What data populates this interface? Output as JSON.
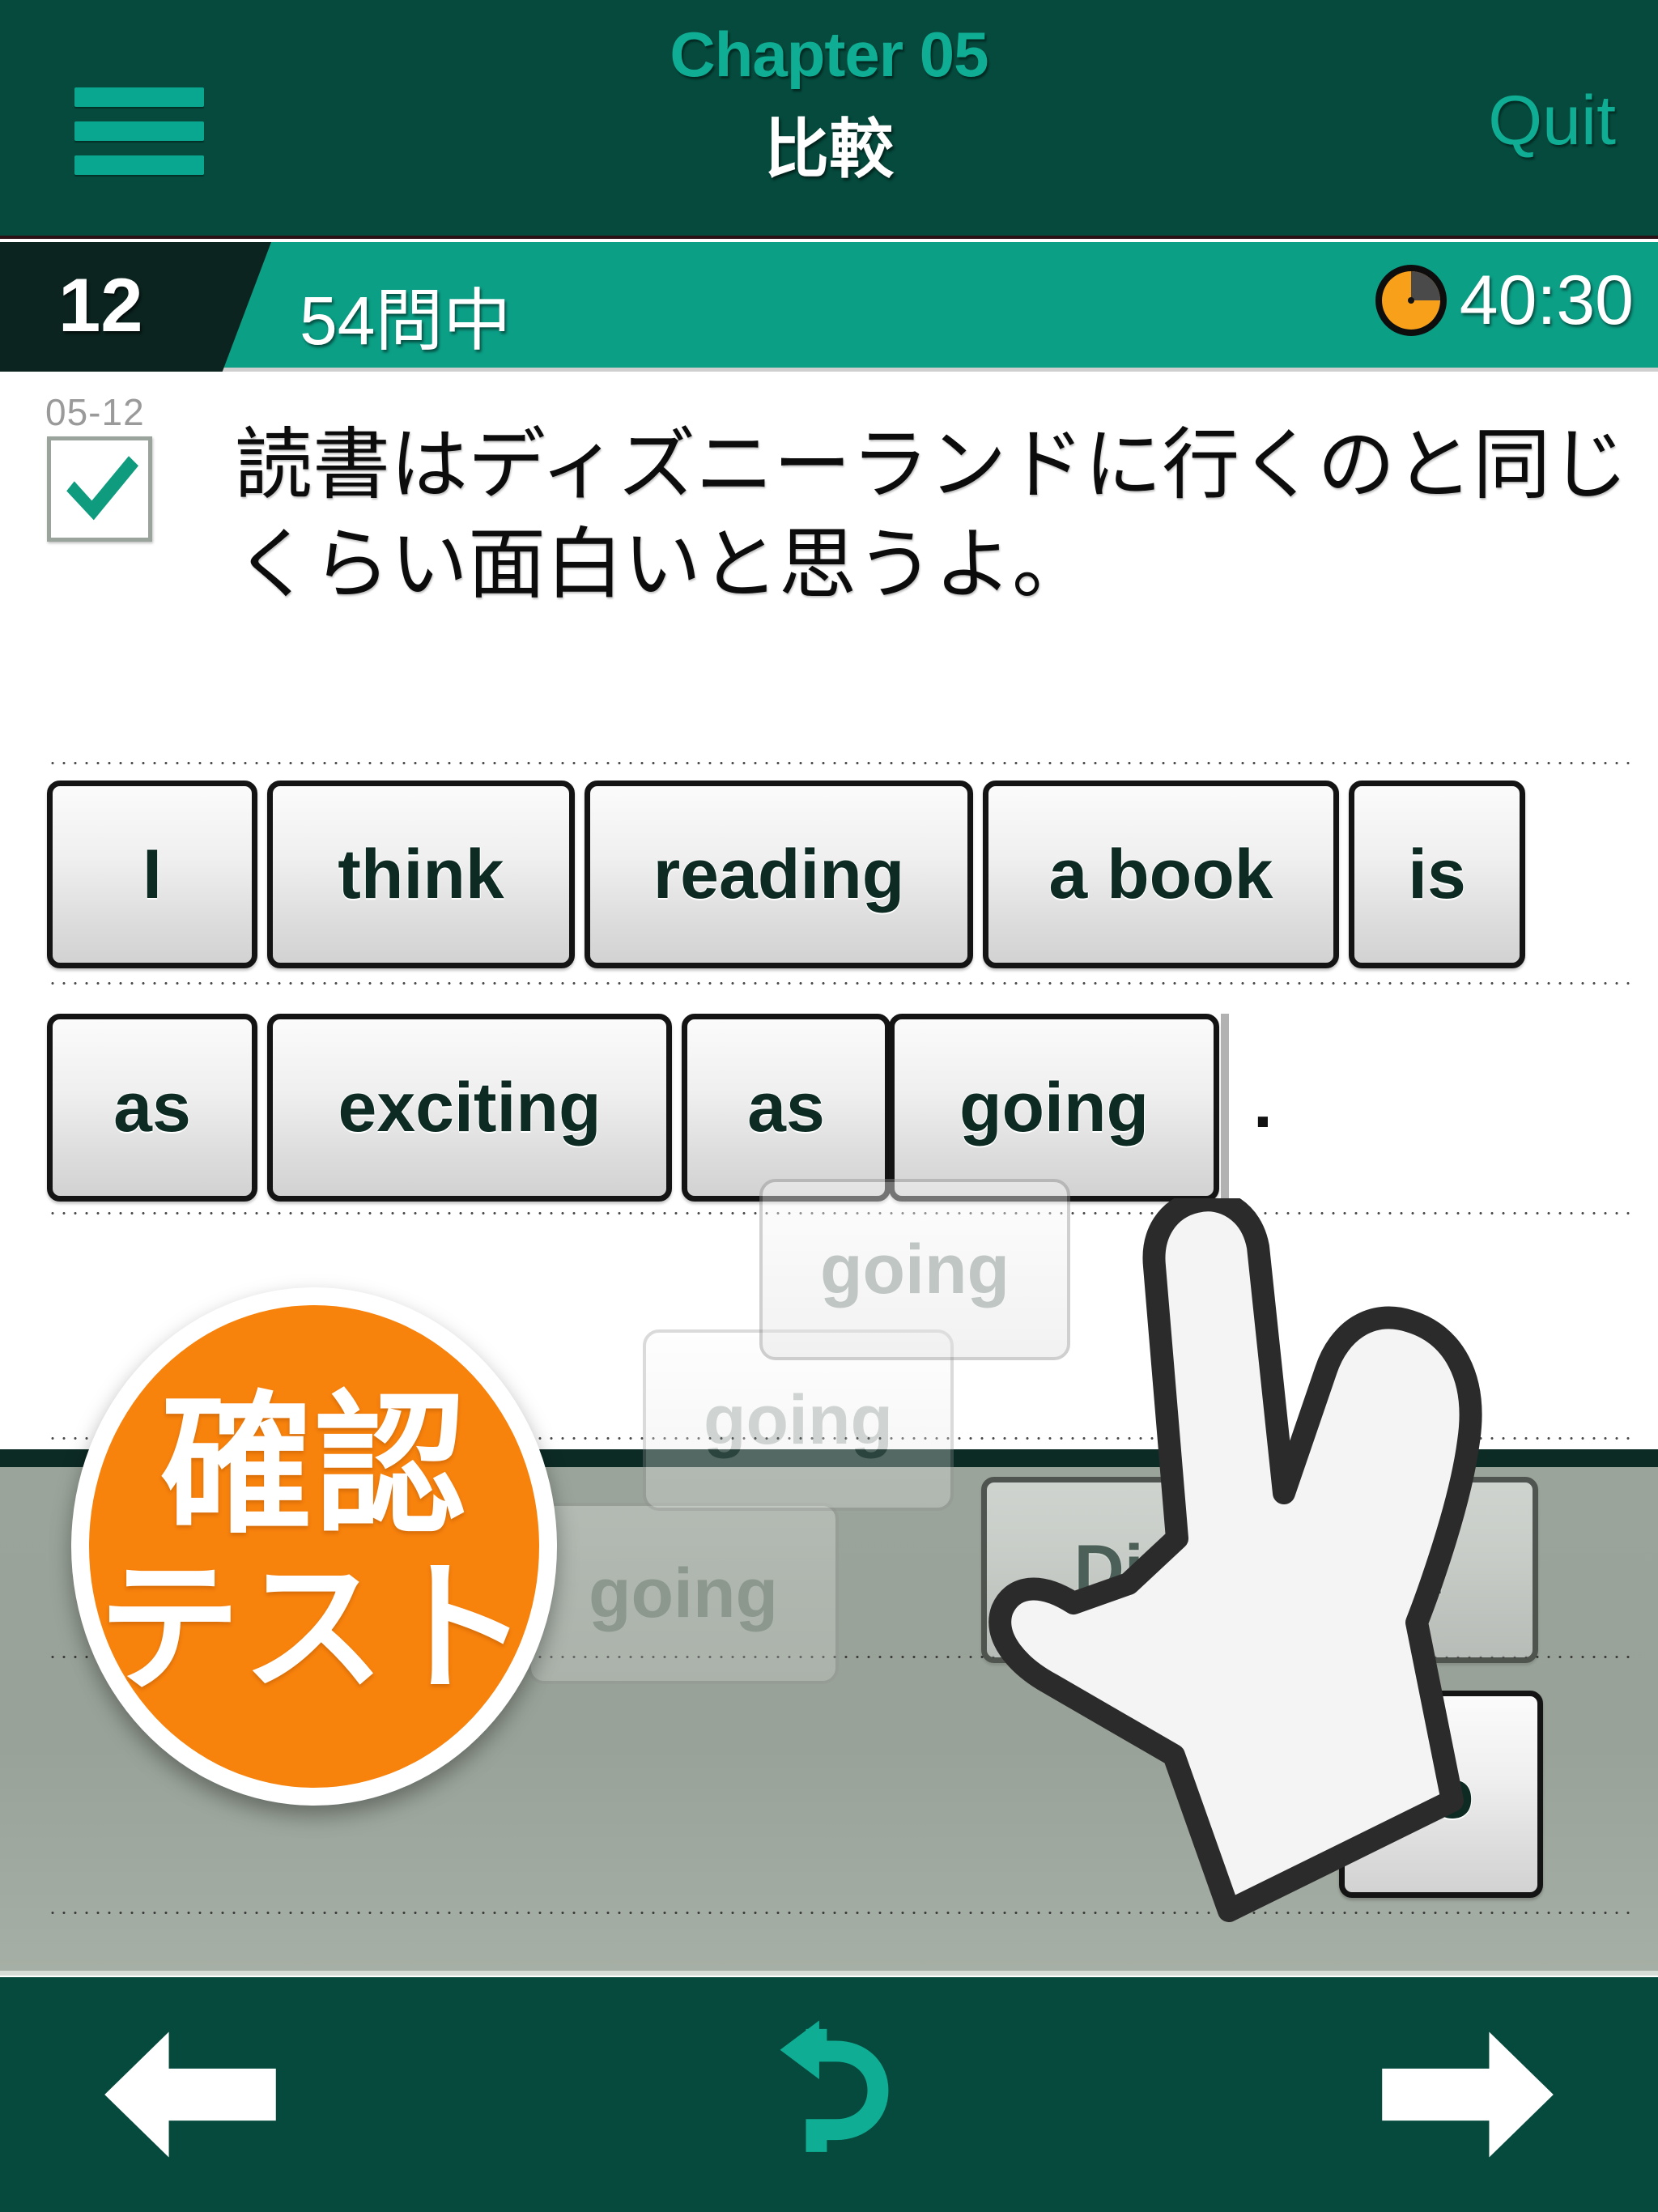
{
  "header": {
    "menu_icon": "hamburger-menu-icon",
    "chapter": "Chapter 05",
    "subtitle": "比較",
    "quit_label": "Quit",
    "bg_color": "#054a3d",
    "accent_color": "#0fae94"
  },
  "progress": {
    "current_question": "12",
    "total_label": "54問中",
    "timer_icon": "clock-icon",
    "timer": "40:30",
    "bg_color": "#0b9f86"
  },
  "question": {
    "id": "05-12",
    "checkbox_icon": "check-mark-icon",
    "checked": true,
    "text": "読書はディズニーランドに行くのと同じくらい面白いと思うよ。"
  },
  "answer": {
    "rows": [
      {
        "tiles": [
          "I",
          "think",
          "reading",
          "a book",
          "is"
        ]
      },
      {
        "tiles": [
          "as",
          "exciting",
          "as",
          "going"
        ]
      }
    ],
    "caret_visible": true,
    "terminator": "."
  },
  "drag": {
    "word": "going",
    "ghost_trail": [
      "going",
      "going",
      "going"
    ]
  },
  "badge": {
    "line1": "確認",
    "line2": "テスト",
    "color": "#f7820c"
  },
  "word_bank": {
    "tiles": [
      "Disneyland",
      "to"
    ],
    "bg_color": "#98a298"
  },
  "cursor": {
    "icon": "pointing-hand-cursor-icon"
  },
  "footer": {
    "prev_icon": "arrow-left-icon",
    "undo_icon": "undo-arrow-icon",
    "next_icon": "arrow-right-icon",
    "accent_color": "#0fae94"
  }
}
